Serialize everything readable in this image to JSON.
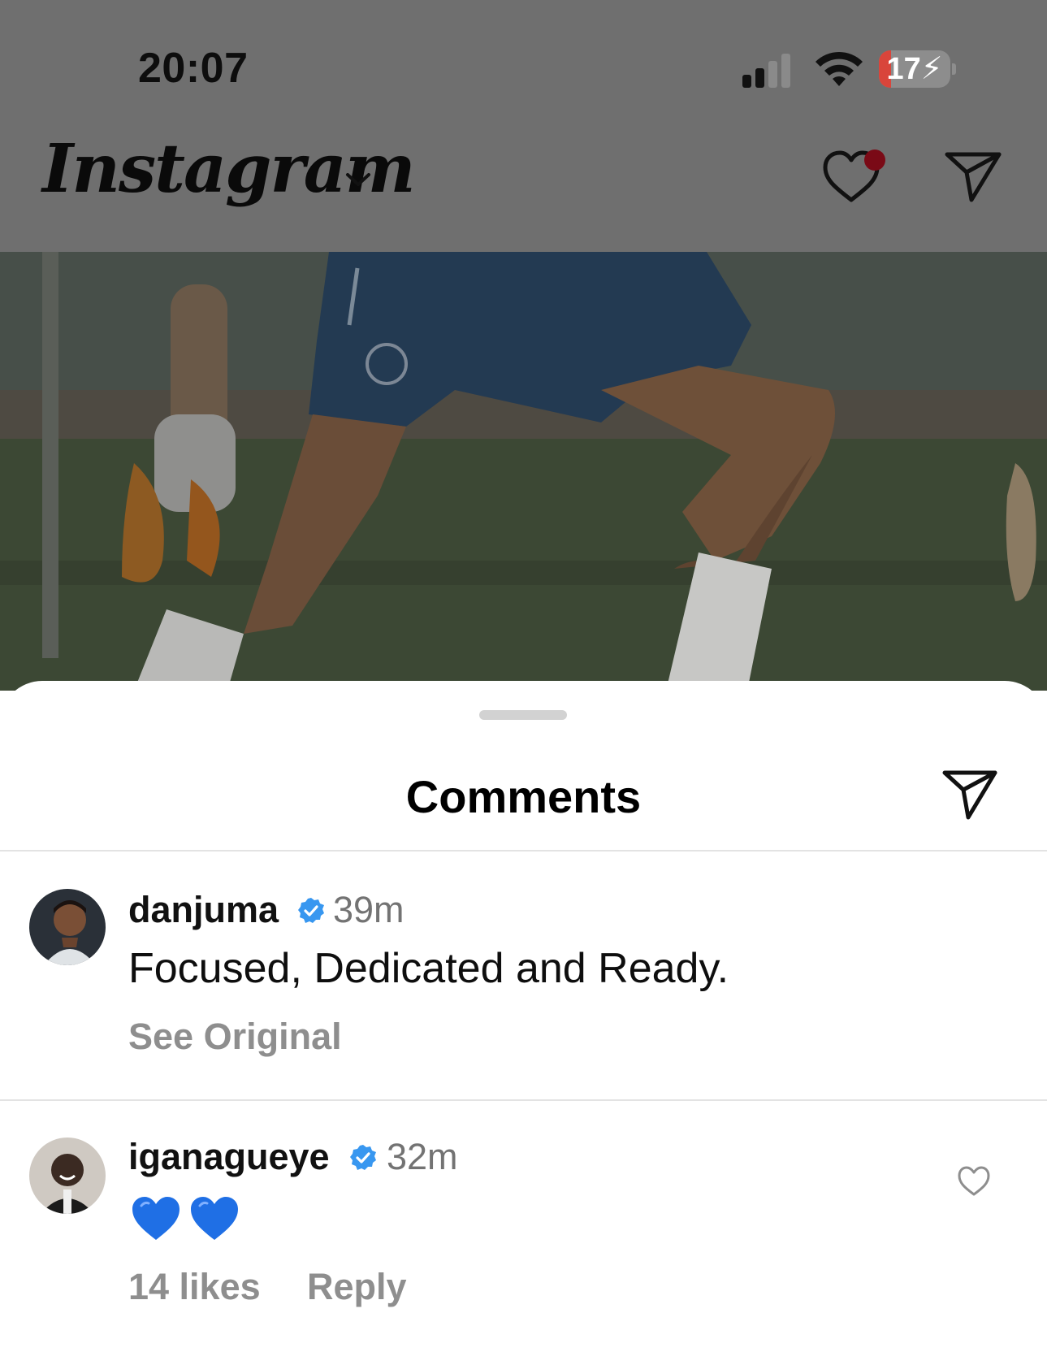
{
  "status_bar": {
    "time": "20:07",
    "battery_level": "17",
    "battery_fraction": 0.17,
    "battery_low_color": "#d9453b"
  },
  "header": {
    "logo_text": "Instagram"
  },
  "sheet": {
    "title": "Comments"
  },
  "comments": [
    {
      "username": "danjuma",
      "verified": true,
      "time": "39m",
      "text": "Focused, Dedicated and Ready.",
      "see_original": "See Original"
    },
    {
      "username": "iganagueye",
      "verified": true,
      "time": "32m",
      "text_emoji": "blue-heart blue-heart",
      "likes": "14 likes",
      "reply": "Reply"
    }
  ],
  "colors": {
    "verified_blue": "#3897f0",
    "blue_heart": "#1f6fe5",
    "secondary_text": "#8e8e8e"
  }
}
